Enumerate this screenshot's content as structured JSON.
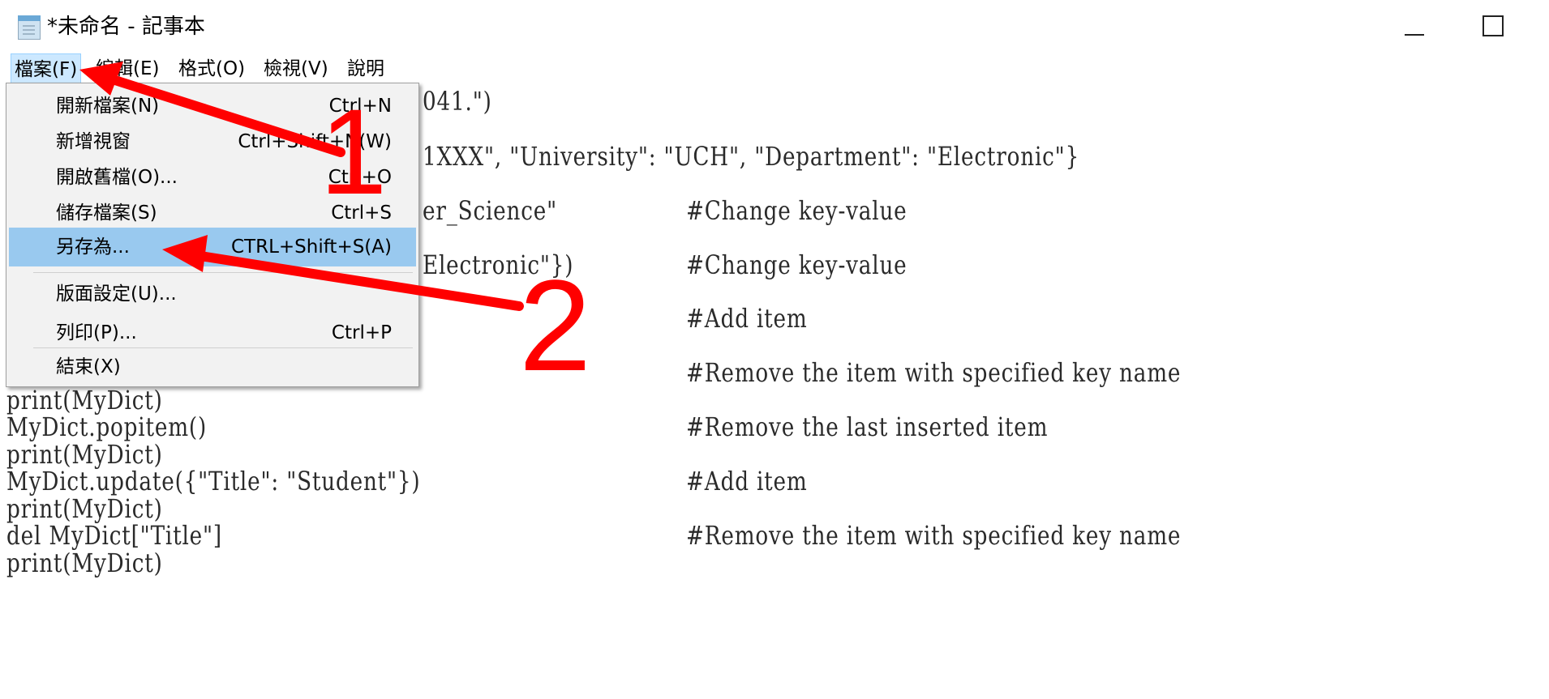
{
  "window": {
    "title": "*未命名 - 記事本"
  },
  "menubar": {
    "items": [
      "檔案(F)",
      "編輯(E)",
      "格式(O)",
      "檢視(V)",
      "說明"
    ]
  },
  "file_menu": {
    "items": [
      {
        "label": "開新檔案(N)",
        "shortcut": "Ctrl+N"
      },
      {
        "label": "新增視窗",
        "shortcut": "Ctrl+Shift+N(W)"
      },
      {
        "label": "開啟舊檔(O)...",
        "shortcut": "Ctrl+O"
      },
      {
        "label": "儲存檔案(S)",
        "shortcut": "Ctrl+S"
      },
      {
        "label": "另存為...",
        "shortcut": "CTRL+Shift+S(A)"
      },
      {
        "label": "版面設定(U)...",
        "shortcut": ""
      },
      {
        "label": "列印(P)...",
        "shortcut": "Ctrl+P"
      },
      {
        "label": "結束(X)",
        "shortcut": ""
      }
    ]
  },
  "editor": {
    "visible_fragments": [
      "041.\")",
      "1XXX\", \"University\": \"UCH\", \"Department\": \"Electronic\"}",
      "er_Science\"",
      "Electronic\"})"
    ],
    "lines": [
      "print(MyDict)",
      "MyDict.popitem()",
      "print(MyDict)",
      "MyDict.update({\"Title\": \"Student\"})",
      "print(MyDict)",
      "del MyDict[\"Title\"]",
      "print(MyDict)"
    ],
    "comments": [
      "#Change key-value",
      "#Change key-value",
      "#Add item",
      "#Remove the item with specified key name",
      "#Remove the last inserted item",
      "#Add item",
      "#Remove the item with specified key name"
    ]
  },
  "annotations": {
    "step1": "1",
    "step2": "2",
    "color": "#ff0000"
  },
  "colors": {
    "menu_highlight": "#99c9ef",
    "menu_background": "#f2f2f2"
  }
}
